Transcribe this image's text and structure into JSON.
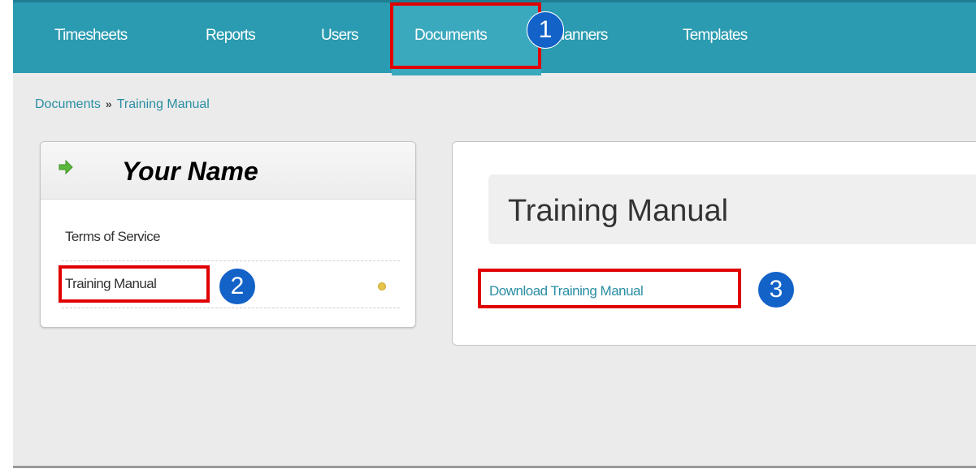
{
  "nav": {
    "items": [
      "Timesheets",
      "Reports",
      "Users",
      "Documents",
      "Planners",
      "Templates"
    ]
  },
  "breadcrumb": {
    "root": "Documents",
    "separator": "»",
    "current": "Training Manual"
  },
  "left_panel": {
    "header_icon": "arrow-right-icon",
    "header_title": "Your Name",
    "items": [
      {
        "label": "Terms of Service"
      },
      {
        "label": "Training Manual"
      }
    ]
  },
  "main": {
    "title": "Training Manual",
    "download_link": "Download Training Manual"
  },
  "annotations": {
    "badges": [
      "1",
      "2",
      "3"
    ]
  },
  "colors": {
    "nav_bg": "#2a9bb0",
    "link": "#2a8ea3",
    "highlight_box": "#e00000",
    "badge": "#1262c8",
    "bullet": "#e6c34a"
  }
}
